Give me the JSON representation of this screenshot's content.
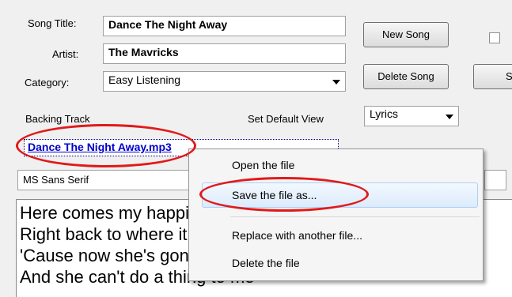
{
  "form": {
    "song_title_label": "Song Title:",
    "song_title_value": "Dance The Night Away",
    "artist_label": "Artist:",
    "artist_value": "The Mavricks",
    "category_label": "Category:",
    "category_value": "Easy Listening",
    "backing_track_label": "Backing Track",
    "default_view_label": "Set Default View",
    "default_view_value": "Lyrics",
    "backing_track_file": "Dance The Night Away.mp3",
    "font_value": "MS Sans Serif"
  },
  "buttons": {
    "new_song": "New Song",
    "delete_song": "Delete Song",
    "partial_right": "S"
  },
  "lyrics": {
    "lines": [
      "Here comes my happiness again",
      "Right back to where it should have been",
      "'Cause now she's gone and I am free",
      "And she can't do a thing to me"
    ]
  },
  "context_menu": {
    "items": [
      "Open the file",
      "Save the file as...",
      "Replace with another file...",
      "Delete the file"
    ]
  },
  "colors": {
    "annotation_red": "#e01a1a",
    "link_blue": "#0000cc",
    "highlight": "#dcebfc"
  }
}
